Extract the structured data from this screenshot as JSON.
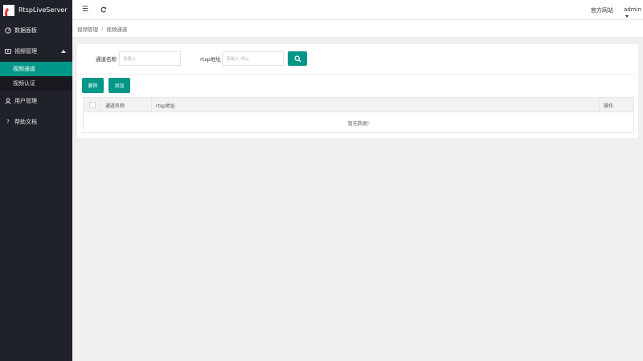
{
  "app": {
    "name": "RtspLiveServer"
  },
  "sidebar": {
    "items": [
      {
        "label": "数据面板",
        "icon": "dashboard-icon"
      },
      {
        "label": "视频管理",
        "icon": "video-icon",
        "expanded": true,
        "children": [
          {
            "label": "视频通道",
            "active": true
          },
          {
            "label": "视频认证",
            "active": false
          }
        ]
      },
      {
        "label": "用户管理",
        "icon": "user-icon"
      },
      {
        "label": "帮助文档",
        "icon": "help-icon"
      }
    ]
  },
  "header": {
    "official_site": "官方网站",
    "user": "admin",
    "menu_icon": "hamburger-icon",
    "refresh_icon": "refresh-icon"
  },
  "breadcrumb": {
    "items": [
      "视频管理",
      "视频通道"
    ],
    "separator": "/"
  },
  "search": {
    "channel_label": "通道名称",
    "channel_placeholder": "请输入",
    "rtsp_label": "rtsp地址",
    "rtsp_placeholder": "请输入 或ip"
  },
  "toolbar": {
    "delete_label": "删除",
    "add_label": "添加"
  },
  "table": {
    "columns": [
      "通道名称",
      "rtsp地址",
      "操作"
    ],
    "rows": [],
    "empty_text": "暂无数据!"
  },
  "colors": {
    "accent": "#009688",
    "sidebar_bg": "#20222a"
  }
}
